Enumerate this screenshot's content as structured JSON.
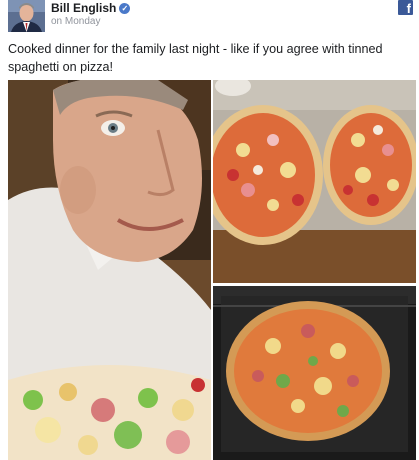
{
  "author": {
    "name": "Bill English",
    "timestamp": "on Monday",
    "verified_icon": "check-icon"
  },
  "network_icon": "facebook-icon",
  "post": {
    "message": "Cooked dinner for the family last night - like if you agree with tinned spaghetti on pizza!"
  },
  "colors": {
    "facebook_blue": "#3b5998",
    "verified_blue": "#4a79c9",
    "text": "#1c1e21",
    "meta_text": "#90949c"
  },
  "photos": [
    {
      "content": "selfie-with-pizza"
    },
    {
      "content": "two-uncooked-pizzas"
    },
    {
      "content": "pizza-in-oven"
    }
  ]
}
